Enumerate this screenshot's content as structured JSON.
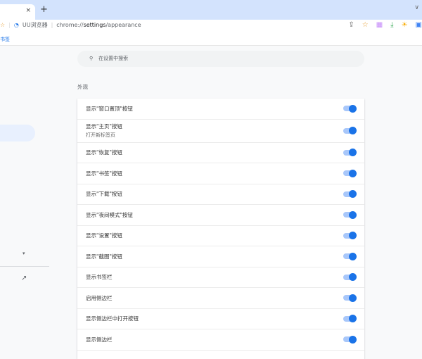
{
  "browser": {
    "tab_close": "×",
    "new_tab": "+",
    "menu_chevron": "∨",
    "site_name": "UU浏览器",
    "url_prefix": "chrome://",
    "url_bold": "settings",
    "url_suffix": "/appearance",
    "bookmark_text": "书签",
    "accent": "#1a73e8"
  },
  "search": {
    "placeholder": "在设置中搜索"
  },
  "section_title": "外观",
  "rows": [
    {
      "label": "显示\"窗口置顶\"按钮",
      "on": true
    },
    {
      "label": "显示\"主页\"按钮",
      "sub": "打开新标签页",
      "on": true
    },
    {
      "label": "显示\"恢复\"按钮",
      "on": true
    },
    {
      "label": "显示\"书签\"按钮",
      "on": true
    },
    {
      "label": "显示\"下载\"按钮",
      "on": true
    },
    {
      "label": "显示\"夜间模式\"按钮",
      "on": true
    },
    {
      "label": "显示\"设置\"按钮",
      "on": true
    },
    {
      "label": "显示\"截图\"按钮",
      "on": true
    },
    {
      "label": "显示书签栏",
      "on": true
    },
    {
      "label": "启用侧边栏",
      "on": true
    },
    {
      "label": "显示侧边栏中打开按钮",
      "on": true
    },
    {
      "label": "显示侧边栏",
      "on": true
    }
  ]
}
